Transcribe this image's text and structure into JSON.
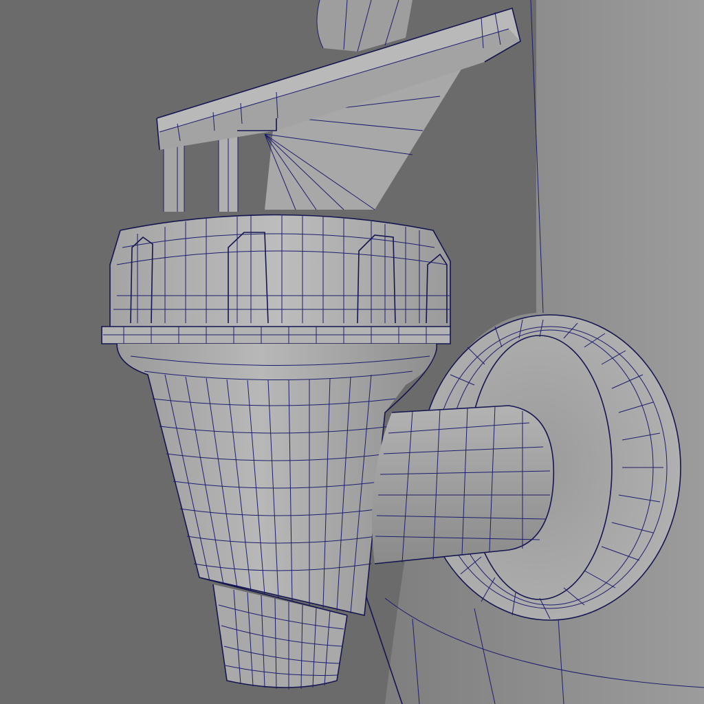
{
  "viewport": {
    "display_mode": "wireframe-on-shaded",
    "colors": {
      "background": "#6b6b6b",
      "wall_shade_dark": "#7a7a7a",
      "wall_shade_light": "#9a9a9a",
      "surface_light": "#b4b4b4",
      "surface_mid": "#a2a2a2",
      "surface_dark": "#8c8c8c",
      "wireframe": "#1c1c6e"
    },
    "objects": [
      "tank-body",
      "tap-lever",
      "tap-cap",
      "tap-cone-body",
      "tap-spout",
      "tap-pipe",
      "tap-flange"
    ]
  }
}
